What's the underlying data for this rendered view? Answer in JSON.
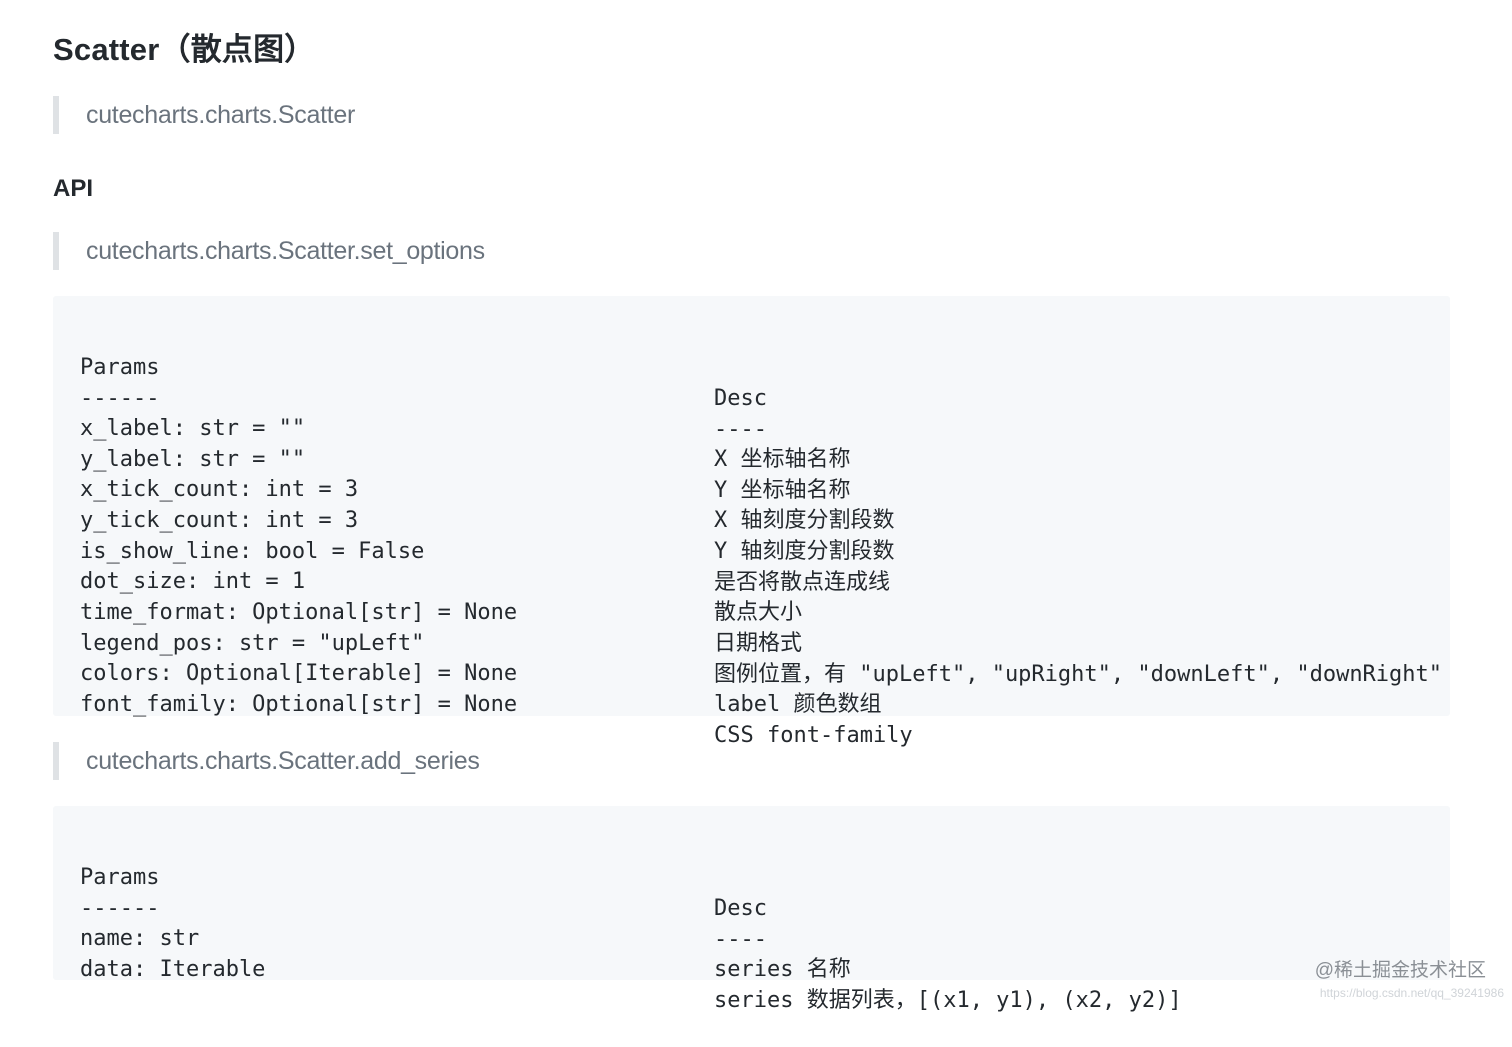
{
  "page_title": "Scatter（散点图）",
  "quote_class": "cutecharts.charts.Scatter",
  "api_heading": "API",
  "set_options": {
    "quote": "cutecharts.charts.Scatter.set_options",
    "header": {
      "params": "Params",
      "desc": "Desc"
    },
    "underline": {
      "params": "------",
      "desc": "----"
    },
    "rows": [
      {
        "param": "x_label: str = \"\"",
        "desc": "X 坐标轴名称"
      },
      {
        "param": "y_label: str = \"\"",
        "desc": "Y 坐标轴名称"
      },
      {
        "param": "x_tick_count: int = 3",
        "desc": "X 轴刻度分割段数"
      },
      {
        "param": "y_tick_count: int = 3",
        "desc": "Y 轴刻度分割段数"
      },
      {
        "param": "is_show_line: bool = False",
        "desc": "是否将散点连成线"
      },
      {
        "param": "dot_size: int = 1",
        "desc": "散点大小"
      },
      {
        "param": "time_format: Optional[str] = None",
        "desc": "日期格式"
      },
      {
        "param": "legend_pos: str = \"upLeft\"",
        "desc": "图例位置，有 \"upLeft\", \"upRight\", \"downLeft\", \"downRight\""
      },
      {
        "param": "colors: Optional[Iterable] = None",
        "desc": "label 颜色数组"
      },
      {
        "param": "font_family: Optional[str] = None",
        "desc": "CSS font-family"
      }
    ]
  },
  "add_series": {
    "quote": "cutecharts.charts.Scatter.add_series",
    "header": {
      "params": "Params",
      "desc": "Desc"
    },
    "underline": {
      "params": "------",
      "desc": "----"
    },
    "rows": [
      {
        "param": "name: str",
        "desc": "series 名称"
      },
      {
        "param": "data: Iterable",
        "desc": "series 数据列表，[(x1, y1), (x2, y2)]"
      }
    ]
  },
  "watermark": {
    "text": "@稀土掘金技术社区",
    "url": "https://blog.csdn.net/qq_39241986"
  }
}
